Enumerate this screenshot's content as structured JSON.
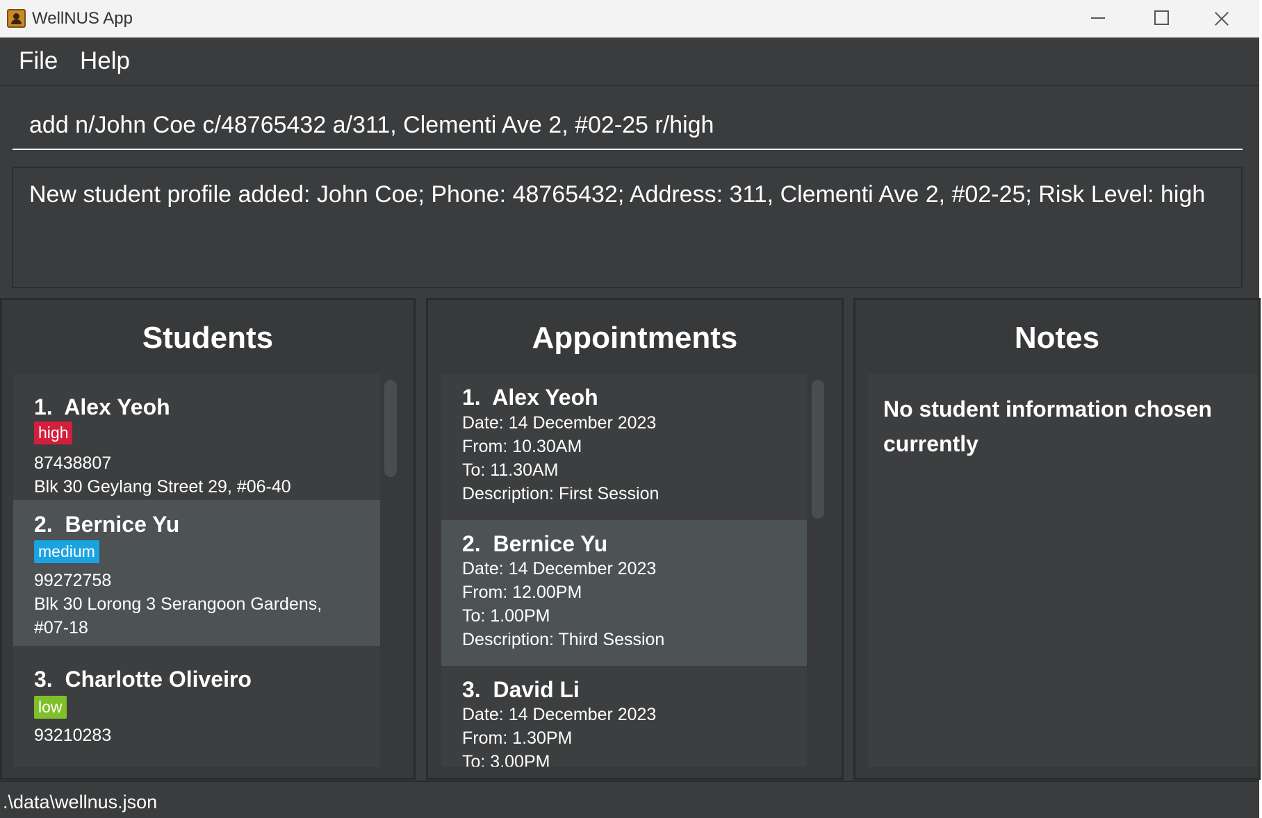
{
  "window": {
    "title": "WellNUS App",
    "controls": [
      "minimize",
      "maximize",
      "close"
    ]
  },
  "menu": {
    "file": "File",
    "help": "Help"
  },
  "command": {
    "value": "add n/John Coe c/48765432 a/311, Clementi Ave 2, #02-25 r/high"
  },
  "result": {
    "text": "New student profile added: John Coe; Phone: 48765432; Address: 311, Clementi Ave 2, #02-25; Risk Level: high"
  },
  "students": {
    "title": "Students",
    "items": [
      {
        "index": "1.",
        "name": "Alex Yeoh",
        "risk": "high",
        "risk_color": "#d21f3c",
        "phone": "87438807",
        "address": "Blk 30 Geylang Street 29, #06-40",
        "address2": ""
      },
      {
        "index": "2.",
        "name": "Bernice Yu",
        "risk": "medium",
        "risk_color": "#1aa3e0",
        "phone": "99272758",
        "address": "Blk 30 Lorong 3 Serangoon Gardens,",
        "address2": "#07-18"
      },
      {
        "index": "3.",
        "name": "Charlotte Oliveiro",
        "risk": "low",
        "risk_color": "#7fbf2a",
        "phone": "93210283",
        "address": "",
        "address2": ""
      }
    ]
  },
  "appointments": {
    "title": "Appointments",
    "items": [
      {
        "index": "1.",
        "name": "Alex Yeoh",
        "date": "Date: 14 December 2023",
        "from": "From: 10.30AM",
        "to": "To: 11.30AM",
        "description": "Description: First Session"
      },
      {
        "index": "2.",
        "name": "Bernice Yu",
        "date": "Date: 14 December 2023",
        "from": "From: 12.00PM",
        "to": "To: 1.00PM",
        "description": "Description: Third Session"
      },
      {
        "index": "3.",
        "name": "David Li",
        "date": "Date: 14 December 2023",
        "from": "From: 1.30PM",
        "to": "To: 3.00PM",
        "description": ""
      }
    ]
  },
  "notes": {
    "title": "Notes",
    "text": "No student information chosen currently"
  },
  "status": {
    "path": ".\\data\\wellnus.json"
  }
}
